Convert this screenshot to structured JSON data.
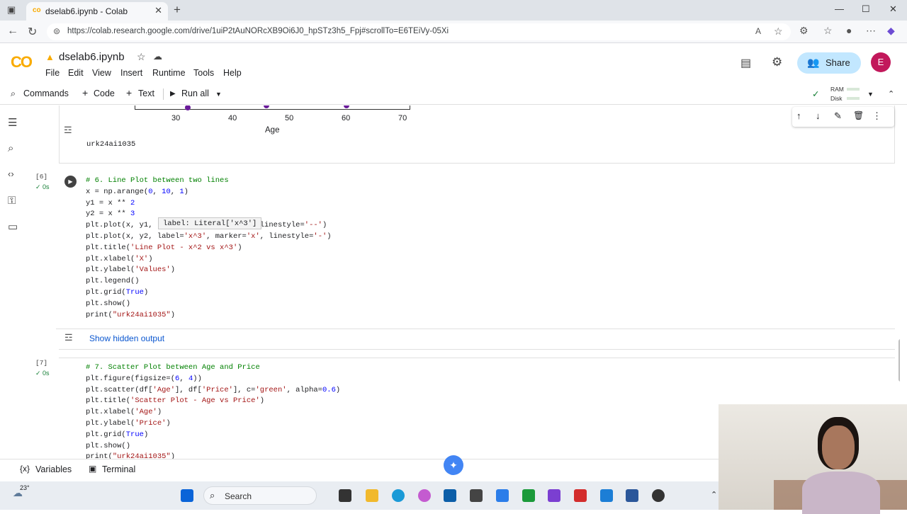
{
  "browser": {
    "tab_title": "dselab6.ipynb - Colab",
    "url": "https://colab.research.google.com/drive/1uiP2tAuNORcXB9Oi6J0_hpSTz3h5_Fpj#scrollTo=E6TEiVy-05Xi"
  },
  "colab": {
    "logo": "CO",
    "notebook_name": "dselab6.ipynb",
    "menu": [
      "File",
      "Edit",
      "View",
      "Insert",
      "Runtime",
      "Tools",
      "Help"
    ],
    "share_label": "Share",
    "avatar_letter": "E",
    "toolbar": {
      "commands": "Commands",
      "code": "Code",
      "text": "Text",
      "run_all": "Run all",
      "ram": "RAM",
      "disk": "Disk"
    }
  },
  "prev_output": {
    "x_ticks": [
      "30",
      "40",
      "50",
      "60",
      "70"
    ],
    "x_label": "Age",
    "print_text": "urk24ai1035"
  },
  "cell6": {
    "exec_count": "[6]",
    "time": "0s",
    "tooltip": "label: Literal['x^3']",
    "show_hidden": "Show hidden output"
  },
  "cell7": {
    "exec_count": "[7]",
    "time": "0s"
  },
  "bottom": {
    "variables": "Variables",
    "terminal": "Terminal"
  },
  "taskbar": {
    "temp": "23°",
    "search": "Search"
  },
  "colors": {
    "accent": "#0b57d0",
    "share_bg": "#c2e7ff",
    "avatar": "#c2185b",
    "purple_points": "#6a1b9a"
  }
}
